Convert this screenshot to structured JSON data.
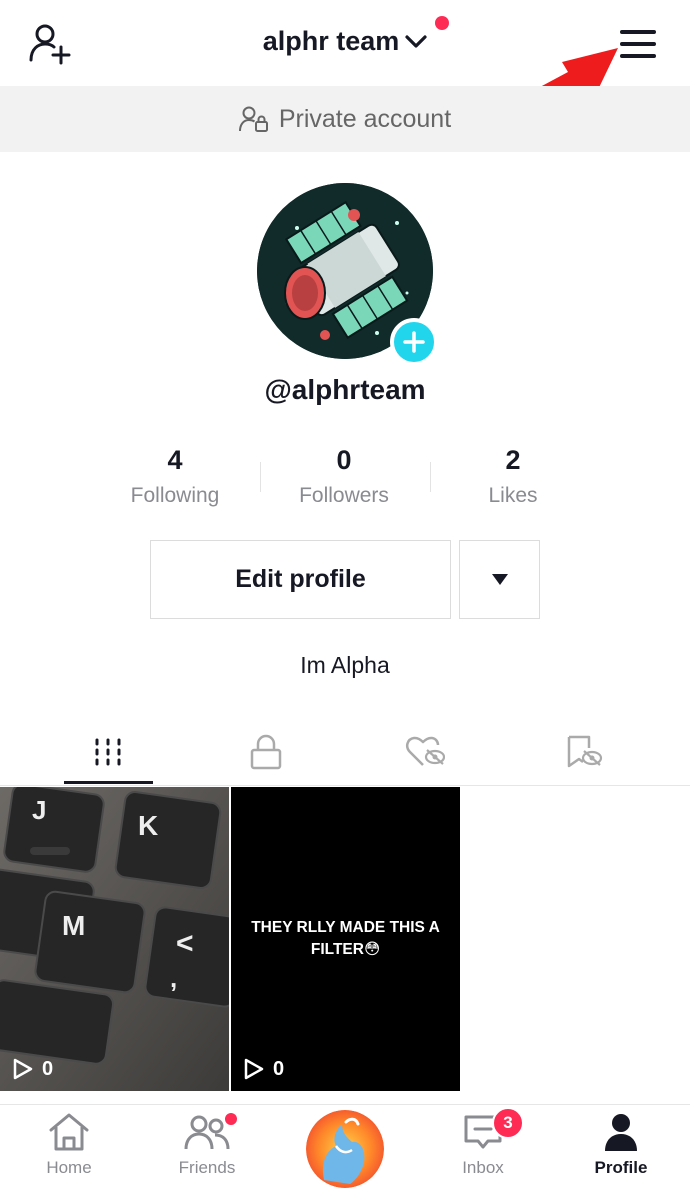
{
  "header": {
    "title": "alphr team",
    "add_user_icon": "add-user-icon",
    "menu_icon": "hamburger-menu-icon",
    "annotation_arrow_color": "#ee1c1c"
  },
  "private_banner": {
    "label": "Private account",
    "icon": "lock-person-icon"
  },
  "profile": {
    "username": "@alphrteam",
    "bio": "Im Alpha",
    "add_avatar_icon": "plus-icon",
    "accent_color": "#20d5ec"
  },
  "stats": [
    {
      "value": "4",
      "label": "Following"
    },
    {
      "value": "0",
      "label": "Followers"
    },
    {
      "value": "2",
      "label": "Likes"
    }
  ],
  "actions": {
    "edit_profile": "Edit profile",
    "more_icon": "caret-down-icon"
  },
  "tabs": [
    {
      "icon": "grid-icon",
      "active": true
    },
    {
      "icon": "lock-icon",
      "active": false
    },
    {
      "icon": "liked-hidden-icon",
      "active": false
    },
    {
      "icon": "bookmark-hidden-icon",
      "active": false
    }
  ],
  "videos": [
    {
      "views": "0",
      "caption": ""
    },
    {
      "views": "0",
      "caption": "THEY RLLY MADE THIS A FILTER😳"
    }
  ],
  "bottom_nav": [
    {
      "label": "Home",
      "icon": "home-icon"
    },
    {
      "label": "Friends",
      "icon": "friends-icon"
    },
    {
      "label": "",
      "icon": "create-icon"
    },
    {
      "label": "Inbox",
      "icon": "inbox-icon",
      "badge": "3"
    },
    {
      "label": "Profile",
      "icon": "profile-icon",
      "active": true
    }
  ],
  "colors": {
    "badge": "#fe2c55",
    "text": "#161823",
    "muted": "#8a8b91"
  }
}
